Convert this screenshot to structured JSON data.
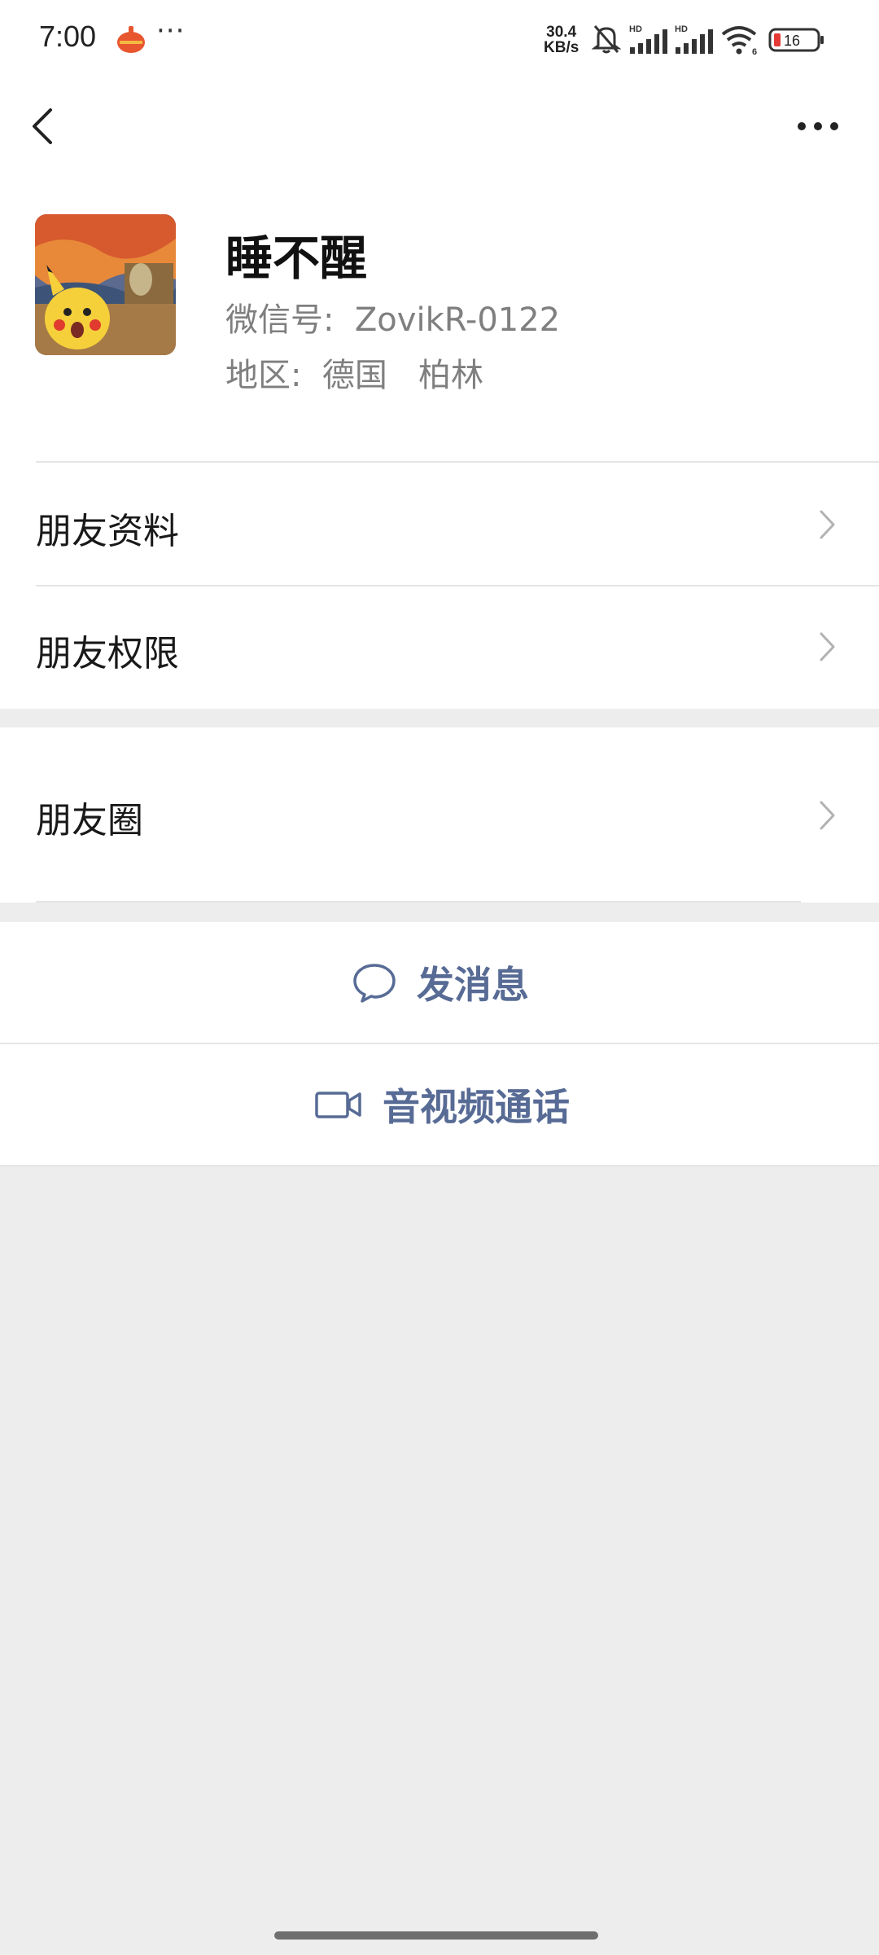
{
  "status_bar": {
    "time": "7:00",
    "more": "···",
    "net_speed_value": "30.4",
    "net_speed_unit": "KB/s",
    "hd1": "HD",
    "hd2": "HD",
    "wifi_badge": "6",
    "battery_level": "16",
    "icons": [
      "app-notification-icon",
      "bell-muted-icon",
      "signal-icon",
      "signal-icon",
      "wifi-icon",
      "battery-icon"
    ]
  },
  "nav": {
    "back_icon": "chevron-left-icon",
    "more_icon": "more-horizontal-icon"
  },
  "profile": {
    "name": "睡不醒",
    "wechat_id_line": "微信号:  ZovikR-0122",
    "region_line": "地区:  德国   柏林"
  },
  "menu": {
    "friend_info": "朋友资料",
    "friend_permissions": "朋友权限",
    "moments": "朋友圈"
  },
  "actions": {
    "send_message": "发消息",
    "av_call": "音视频通话"
  },
  "colors": {
    "link": "#576b95",
    "background": "#ededed",
    "battery_low": "#e53935"
  }
}
